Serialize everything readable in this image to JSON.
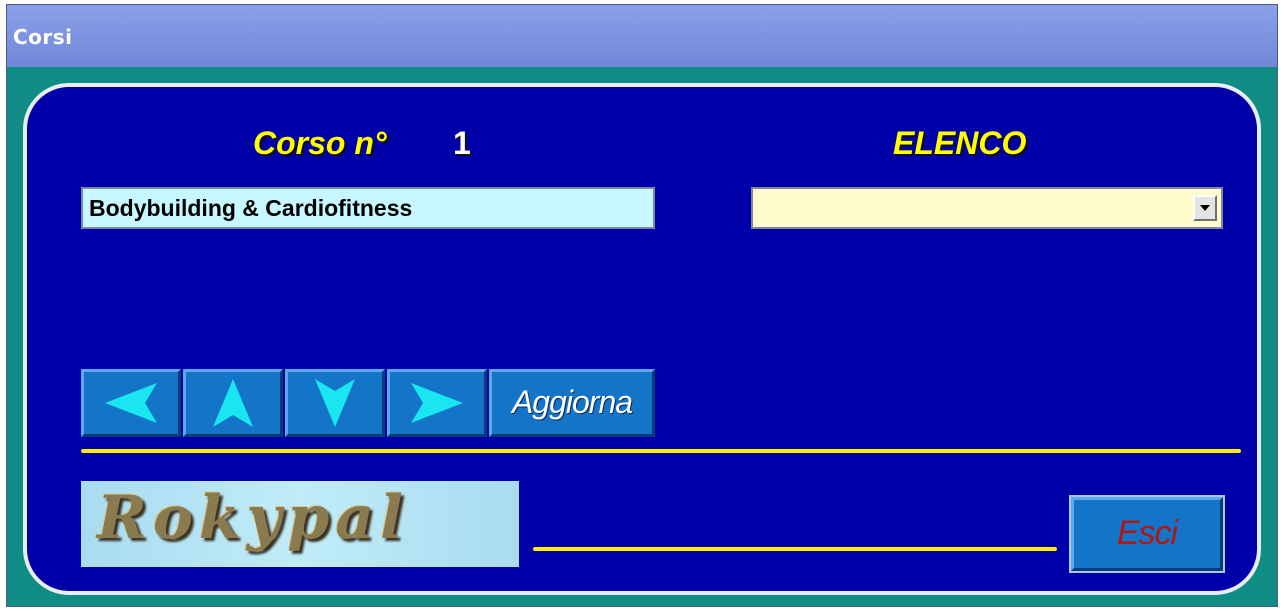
{
  "window": {
    "title": "Corsi"
  },
  "form": {
    "course_label": "Corso n°",
    "course_number": "1",
    "list_label": "ELENCO",
    "course_name_value": "Bodybuilding & Cardiofitness",
    "list_selected_value": ""
  },
  "navigation": {
    "prev_icon": "arrow-left-icon",
    "first_icon": "arrow-up-icon",
    "last_icon": "arrow-down-icon",
    "next_icon": "arrow-right-icon",
    "update_label": "Aggiorna"
  },
  "footer": {
    "logo_text": "Rokypal",
    "exit_label": "Esci"
  },
  "colors": {
    "window_background": "#0f8c83",
    "panel_background": "#0000a8",
    "heading_text": "#ffff00",
    "button_face": "#1474c8",
    "arrow_fill": "#19e6f0",
    "exit_text": "#b01818",
    "course_field_background": "#c8f8ff",
    "list_field_background": "#fffccc"
  }
}
